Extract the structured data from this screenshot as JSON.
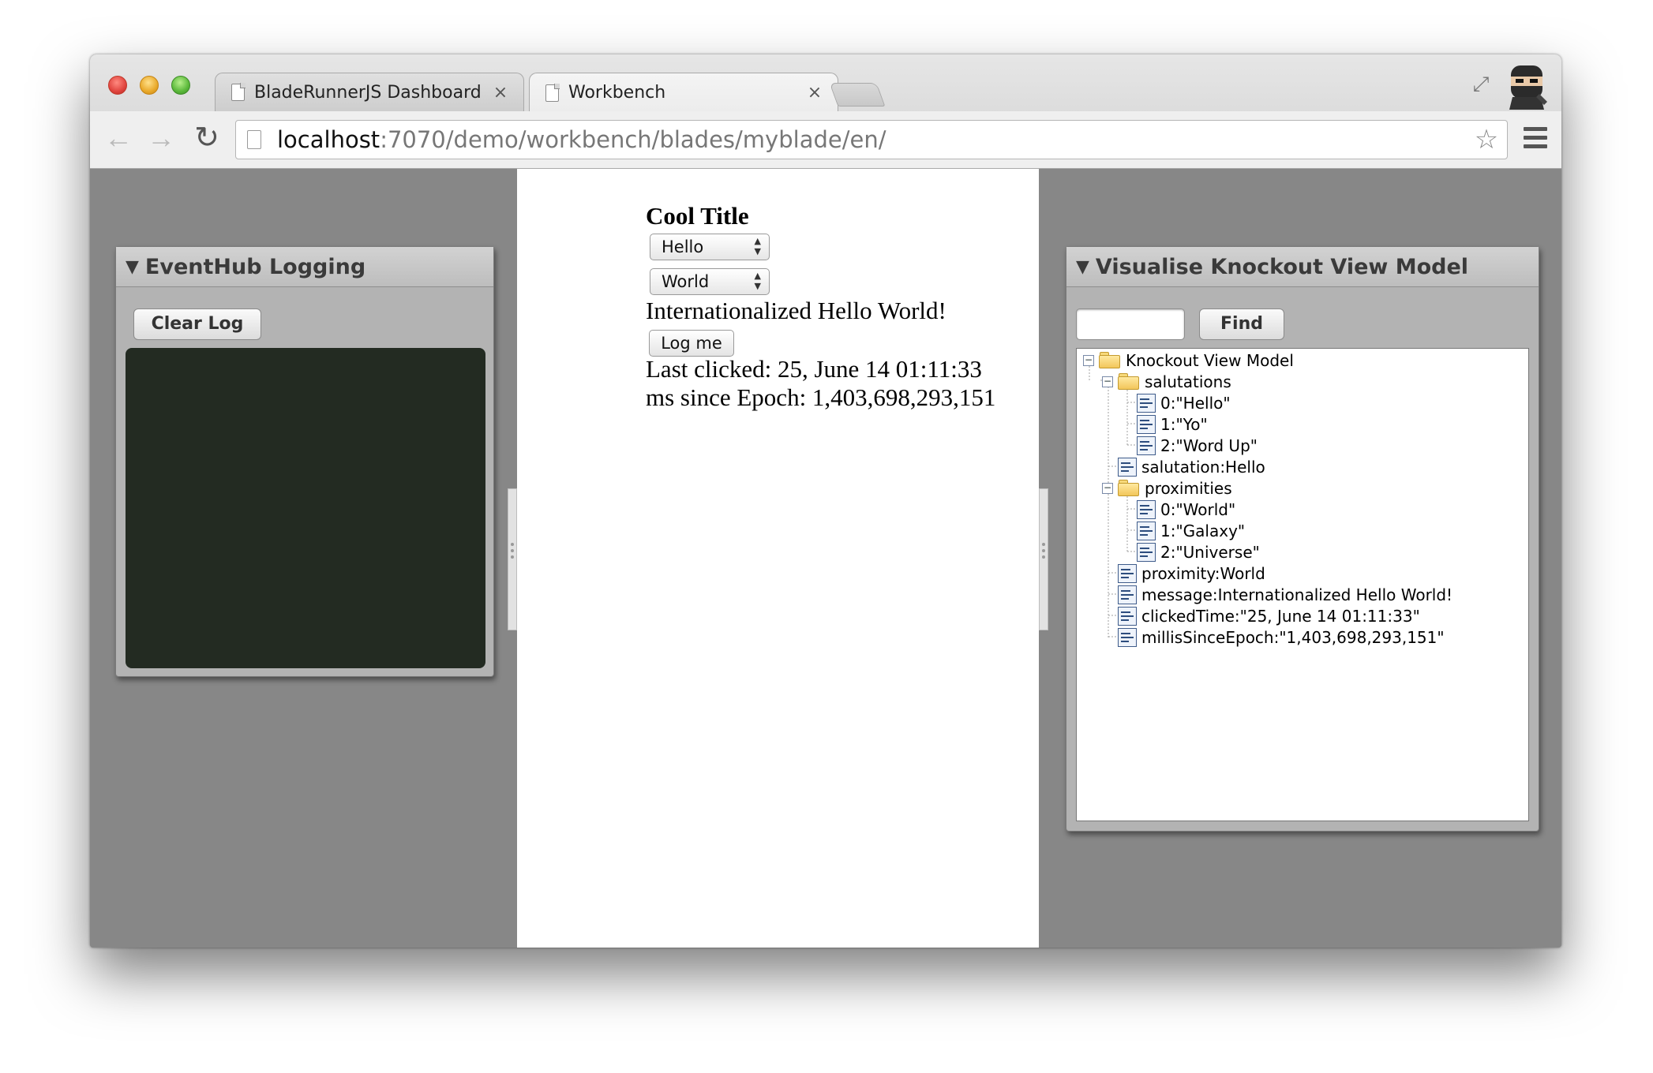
{
  "browser": {
    "tabs": [
      {
        "title": "BladeRunnerJS Dashboard",
        "close": "×",
        "active": false
      },
      {
        "title": "Workbench",
        "close": "×",
        "active": true
      }
    ],
    "url_host": "localhost",
    "url_path": ":7070/demo/workbench/blades/myblade/en/",
    "back_glyph": "←",
    "forward_glyph": "→",
    "reload_glyph": "↻",
    "star_glyph": "☆",
    "fullscreen_glyph": "⤢",
    "icons": [
      "back-arrow-icon",
      "forward-arrow-icon",
      "reload-icon",
      "page-icon",
      "bookmark-star-icon",
      "menu-icon",
      "fullscreen-icon",
      "ninja-avatar-icon"
    ]
  },
  "eventhub_panel": {
    "title": "EventHub Logging",
    "toggle": "▼",
    "clear_button": "Clear Log",
    "log_color": "#232b22"
  },
  "workbench": {
    "title": "Cool Title",
    "salutation_select": "Hello",
    "proximity_select": "World",
    "select_arrows": "▲▼",
    "message": "Internationalized Hello World!",
    "log_button": "Log me",
    "last_clicked": "Last clicked: 25, June 14 01:11:33",
    "ms_since_epoch": "ms since Epoch: 1,403,698,293,151"
  },
  "knockout_panel": {
    "title": "Visualise Knockout View Model",
    "toggle": "▼",
    "search_value": "",
    "find_button": "Find",
    "tree": {
      "root": "Knockout View Model",
      "salutations": "salutations",
      "salutation_items": [
        "0:\"Hello\"",
        "1:\"Yo\"",
        "2:\"Word Up\""
      ],
      "salutation": "salutation:Hello",
      "proximities": "proximities",
      "proximity_items": [
        "0:\"World\"",
        "1:\"Galaxy\"",
        "2:\"Universe\""
      ],
      "proximity": "proximity:World",
      "message": "message:Internationalized Hello World!",
      "clicked_time": "clickedTime:\"25, June 14 01:11:33\"",
      "millis_since_epoch": "millisSinceEpoch:\"1,403,698,293,151\"",
      "expander_glyph": "−"
    }
  }
}
